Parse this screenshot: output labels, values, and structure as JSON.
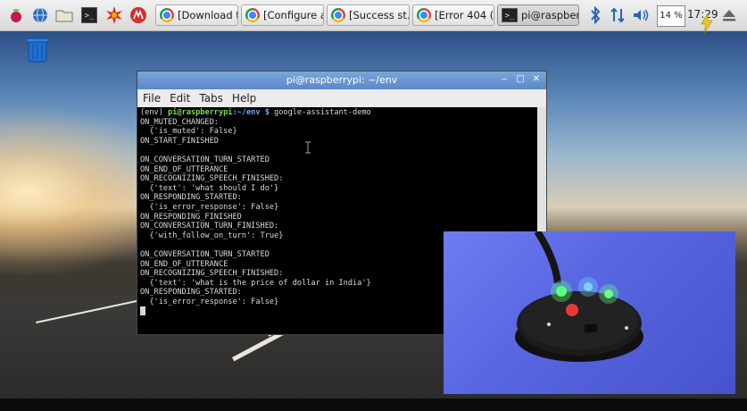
{
  "taskbar": {
    "launchers": [
      {
        "name": "raspberry-menu-icon"
      },
      {
        "name": "browser-globe-icon"
      },
      {
        "name": "file-manager-icon"
      },
      {
        "name": "terminal-icon"
      },
      {
        "name": "starburst-app-icon"
      },
      {
        "name": "wolfram-icon"
      }
    ],
    "tasks": [
      {
        "label": "[Download t...",
        "icon": "chrome-icon"
      },
      {
        "label": "[Configure a...",
        "icon": "chrome-icon"
      },
      {
        "label": "[Success st...",
        "icon": "chrome-icon"
      },
      {
        "label": "[Error 404 (...",
        "icon": "chrome-icon"
      },
      {
        "label": "pi@raspber...",
        "icon": "terminal-icon"
      }
    ],
    "tray": {
      "cpu_label": "14 %",
      "clock": "17:29"
    }
  },
  "terminal": {
    "title": "pi@raspberrypi: ~/env",
    "menu": [
      "File",
      "Edit",
      "Tabs",
      "Help"
    ],
    "prompt_env": "(env) ",
    "prompt_user": "pi@raspberrypi",
    "prompt_path": ":~/env $",
    "command": " google-assistant-demo",
    "lines": [
      "ON_MUTED_CHANGED:",
      "  {'is_muted': False}",
      "ON_START_FINISHED",
      "",
      "ON_CONVERSATION_TURN_STARTED",
      "ON_END_OF_UTTERANCE",
      "ON_RECOGNIZING_SPEECH_FINISHED:",
      "  {'text': 'what should I do'}",
      "ON_RESPONDING_STARTED:",
      "  {'is_error_response': False}",
      "ON_RESPONDING_FINISHED",
      "ON_CONVERSATION_TURN_FINISHED:",
      "  {'with_follow_on_turn': True}",
      "",
      "ON_CONVERSATION_TURN_STARTED",
      "ON_END_OF_UTTERANCE",
      "ON_RECOGNIZING_SPEECH_FINISHED:",
      "  {'text': 'what is the price of dollar in India'}",
      "ON_RESPONDING_STARTED:",
      "  {'is_error_response': False}"
    ]
  }
}
